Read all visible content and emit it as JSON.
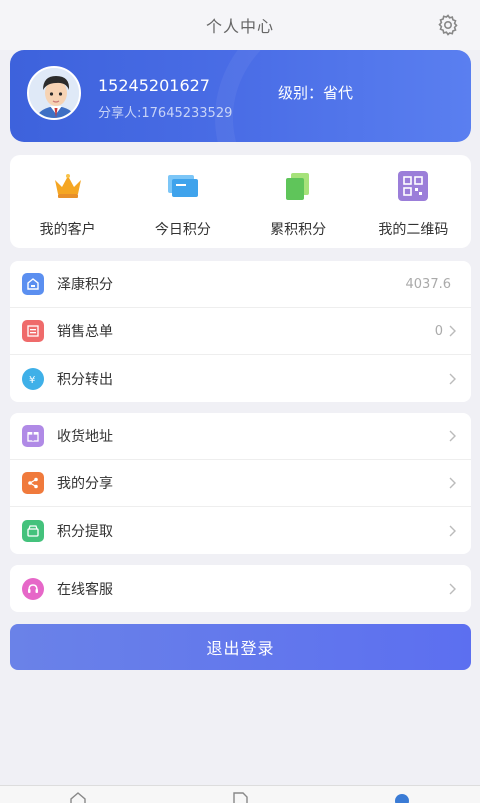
{
  "header": {
    "title": "个人中心",
    "settings_icon": "gear-icon"
  },
  "profile": {
    "phone": "15245201627",
    "sharer": "分享人:17645233529",
    "level": "级别：省代"
  },
  "quick_actions": [
    {
      "label": "我的客户",
      "icon": "crown-icon"
    },
    {
      "label": "今日积分",
      "icon": "cards-icon"
    },
    {
      "label": "累积积分",
      "icon": "stack-icon"
    },
    {
      "label": "我的二维码",
      "icon": "qrcode-icon"
    }
  ],
  "group1": [
    {
      "label": "泽康积分",
      "value": "4037.6",
      "icon": "points-icon"
    },
    {
      "label": "销售总单",
      "value": "0",
      "icon": "orders-icon"
    },
    {
      "label": "积分转出",
      "value": "",
      "icon": "transfer-icon"
    }
  ],
  "group2": [
    {
      "label": "收货地址",
      "icon": "gift-icon"
    },
    {
      "label": "我的分享",
      "icon": "share-icon"
    },
    {
      "label": "积分提取",
      "icon": "withdraw-icon"
    }
  ],
  "group3": [
    {
      "label": "在线客服",
      "icon": "support-icon"
    }
  ],
  "logout_label": "退出登录",
  "colors": {
    "accent": "#4a6de6",
    "logout": "#6070ee"
  }
}
